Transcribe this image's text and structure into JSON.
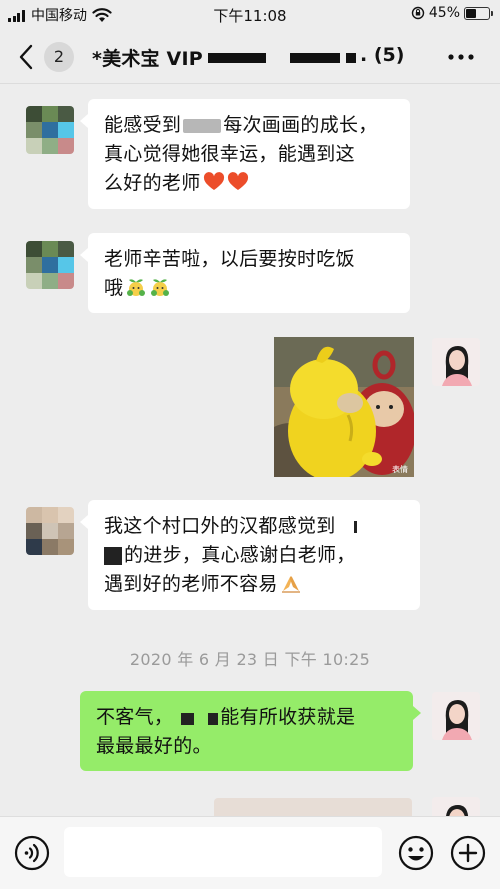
{
  "status_bar": {
    "carrier": "中国移动",
    "time": "下午11:08",
    "battery": "45%",
    "battery_level": 0.45
  },
  "header": {
    "unread_count": "2",
    "title": "*美术宝 VIP",
    "member_count": ". (5)"
  },
  "messages": [
    {
      "direction": "incoming",
      "lines": [
        "能感受到",
        "每次画画的成长，",
        "真心觉得她很幸运，能遇到这",
        "么好的老师"
      ],
      "emoji": [
        "heart",
        "heart"
      ]
    },
    {
      "direction": "incoming",
      "lines": [
        "老师辛苦啦，以后要按时吃饭",
        "哦"
      ],
      "emoji": [
        "sprout-face",
        "sprout-face"
      ]
    },
    {
      "direction": "outgoing",
      "type": "image",
      "caption": "表情"
    },
    {
      "direction": "incoming",
      "lines": [
        "我这个村口外的汉都感觉到",
        "的进步，真心感谢白老师，",
        "遇到好的老师不容易"
      ],
      "emoji": [
        "praying-hands"
      ]
    },
    {
      "direction": "outgoing",
      "lines": [
        "不客气，",
        "能有所收获就是",
        "最最最好的。"
      ]
    }
  ],
  "timestamp": "2020 年 6 月 23 日 下午 10:25",
  "input_bar": {
    "placeholder": ""
  },
  "colors": {
    "background": "#ededed",
    "incoming_bubble": "#ffffff",
    "outgoing_bubble": "#95ec69",
    "timestamp": "#9a9a9a"
  },
  "icons": [
    "back-chevron-icon",
    "more-dots-icon",
    "voice-icon",
    "emoji-icon",
    "plus-icon",
    "heart-icon",
    "sprout-face-icon",
    "praying-hands-icon",
    "wifi-icon",
    "lock-rotation-icon"
  ]
}
